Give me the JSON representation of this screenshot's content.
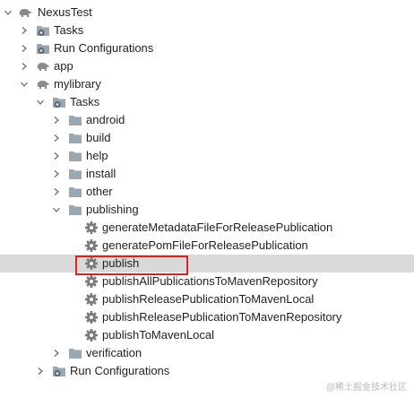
{
  "tree": {
    "root": "NexusTest",
    "tasks_top": "Tasks",
    "run_config_top": "Run Configurations",
    "app": "app",
    "mylibrary": "mylibrary",
    "tasks": "Tasks",
    "android": "android",
    "build": "build",
    "help": "help",
    "install": "install",
    "other": "other",
    "publishing": "publishing",
    "publishing_tasks": [
      "generateMetadataFileForReleasePublication",
      "generatePomFileForReleasePublication",
      "publish",
      "publishAllPublicationsToMavenRepository",
      "publishReleasePublicationToMavenLocal",
      "publishReleasePublicationToMavenRepository",
      "publishToMavenLocal"
    ],
    "verification": "verification",
    "run_config_lib": "Run Configurations"
  },
  "selected_item": "publish",
  "highlight_color": "#e02020",
  "watermark": "@稀土掘金技术社区"
}
